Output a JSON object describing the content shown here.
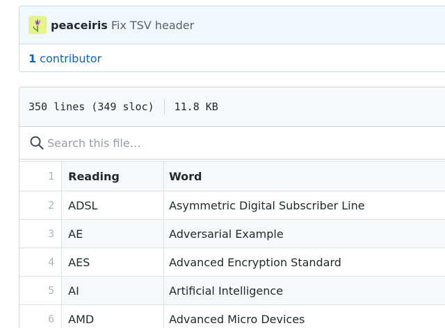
{
  "commit": {
    "author": "peaceiris",
    "message": "Fix TSV header",
    "contributors_count": "1",
    "contributors_label": "contributor"
  },
  "file": {
    "lines": "350 lines (349 sloc)",
    "size": "11.8 KB"
  },
  "search": {
    "placeholder": "Search this file…"
  },
  "table": {
    "line_numbers": [
      "1",
      "2",
      "3",
      "4",
      "5",
      "6"
    ],
    "header": [
      "Reading",
      "Word"
    ],
    "rows": [
      [
        "ADSL",
        "Asymmetric Digital Subscriber Line"
      ],
      [
        "AE",
        "Adversarial Example"
      ],
      [
        "AES",
        "Advanced Encryption Standard"
      ],
      [
        "AI",
        "Artificial Intelligence"
      ],
      [
        "AMD",
        "Advanced Micro Devices"
      ]
    ]
  },
  "colors": {
    "link": "#0366d6",
    "avatar_bg": "#e6f28c"
  }
}
